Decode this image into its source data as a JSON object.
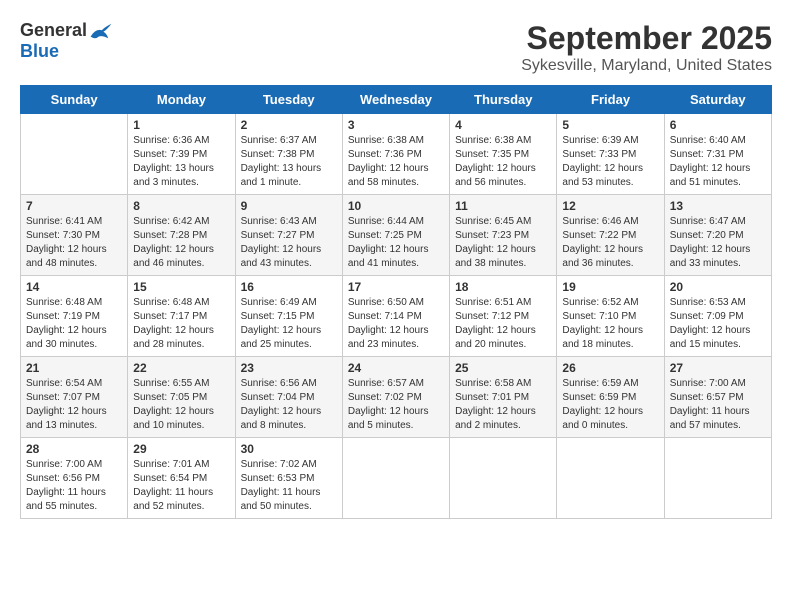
{
  "logo": {
    "general": "General",
    "blue": "Blue"
  },
  "title": "September 2025",
  "subtitle": "Sykesville, Maryland, United States",
  "weekdays": [
    "Sunday",
    "Monday",
    "Tuesday",
    "Wednesday",
    "Thursday",
    "Friday",
    "Saturday"
  ],
  "weeks": [
    {
      "shade": "light",
      "days": [
        {
          "num": "",
          "sunrise": "",
          "sunset": "",
          "daylight": ""
        },
        {
          "num": "1",
          "sunrise": "Sunrise: 6:36 AM",
          "sunset": "Sunset: 7:39 PM",
          "daylight": "Daylight: 13 hours and 3 minutes."
        },
        {
          "num": "2",
          "sunrise": "Sunrise: 6:37 AM",
          "sunset": "Sunset: 7:38 PM",
          "daylight": "Daylight: 13 hours and 1 minute."
        },
        {
          "num": "3",
          "sunrise": "Sunrise: 6:38 AM",
          "sunset": "Sunset: 7:36 PM",
          "daylight": "Daylight: 12 hours and 58 minutes."
        },
        {
          "num": "4",
          "sunrise": "Sunrise: 6:38 AM",
          "sunset": "Sunset: 7:35 PM",
          "daylight": "Daylight: 12 hours and 56 minutes."
        },
        {
          "num": "5",
          "sunrise": "Sunrise: 6:39 AM",
          "sunset": "Sunset: 7:33 PM",
          "daylight": "Daylight: 12 hours and 53 minutes."
        },
        {
          "num": "6",
          "sunrise": "Sunrise: 6:40 AM",
          "sunset": "Sunset: 7:31 PM",
          "daylight": "Daylight: 12 hours and 51 minutes."
        }
      ]
    },
    {
      "shade": "gray",
      "days": [
        {
          "num": "7",
          "sunrise": "Sunrise: 6:41 AM",
          "sunset": "Sunset: 7:30 PM",
          "daylight": "Daylight: 12 hours and 48 minutes."
        },
        {
          "num": "8",
          "sunrise": "Sunrise: 6:42 AM",
          "sunset": "Sunset: 7:28 PM",
          "daylight": "Daylight: 12 hours and 46 minutes."
        },
        {
          "num": "9",
          "sunrise": "Sunrise: 6:43 AM",
          "sunset": "Sunset: 7:27 PM",
          "daylight": "Daylight: 12 hours and 43 minutes."
        },
        {
          "num": "10",
          "sunrise": "Sunrise: 6:44 AM",
          "sunset": "Sunset: 7:25 PM",
          "daylight": "Daylight: 12 hours and 41 minutes."
        },
        {
          "num": "11",
          "sunrise": "Sunrise: 6:45 AM",
          "sunset": "Sunset: 7:23 PM",
          "daylight": "Daylight: 12 hours and 38 minutes."
        },
        {
          "num": "12",
          "sunrise": "Sunrise: 6:46 AM",
          "sunset": "Sunset: 7:22 PM",
          "daylight": "Daylight: 12 hours and 36 minutes."
        },
        {
          "num": "13",
          "sunrise": "Sunrise: 6:47 AM",
          "sunset": "Sunset: 7:20 PM",
          "daylight": "Daylight: 12 hours and 33 minutes."
        }
      ]
    },
    {
      "shade": "light",
      "days": [
        {
          "num": "14",
          "sunrise": "Sunrise: 6:48 AM",
          "sunset": "Sunset: 7:19 PM",
          "daylight": "Daylight: 12 hours and 30 minutes."
        },
        {
          "num": "15",
          "sunrise": "Sunrise: 6:48 AM",
          "sunset": "Sunset: 7:17 PM",
          "daylight": "Daylight: 12 hours and 28 minutes."
        },
        {
          "num": "16",
          "sunrise": "Sunrise: 6:49 AM",
          "sunset": "Sunset: 7:15 PM",
          "daylight": "Daylight: 12 hours and 25 minutes."
        },
        {
          "num": "17",
          "sunrise": "Sunrise: 6:50 AM",
          "sunset": "Sunset: 7:14 PM",
          "daylight": "Daylight: 12 hours and 23 minutes."
        },
        {
          "num": "18",
          "sunrise": "Sunrise: 6:51 AM",
          "sunset": "Sunset: 7:12 PM",
          "daylight": "Daylight: 12 hours and 20 minutes."
        },
        {
          "num": "19",
          "sunrise": "Sunrise: 6:52 AM",
          "sunset": "Sunset: 7:10 PM",
          "daylight": "Daylight: 12 hours and 18 minutes."
        },
        {
          "num": "20",
          "sunrise": "Sunrise: 6:53 AM",
          "sunset": "Sunset: 7:09 PM",
          "daylight": "Daylight: 12 hours and 15 minutes."
        }
      ]
    },
    {
      "shade": "gray",
      "days": [
        {
          "num": "21",
          "sunrise": "Sunrise: 6:54 AM",
          "sunset": "Sunset: 7:07 PM",
          "daylight": "Daylight: 12 hours and 13 minutes."
        },
        {
          "num": "22",
          "sunrise": "Sunrise: 6:55 AM",
          "sunset": "Sunset: 7:05 PM",
          "daylight": "Daylight: 12 hours and 10 minutes."
        },
        {
          "num": "23",
          "sunrise": "Sunrise: 6:56 AM",
          "sunset": "Sunset: 7:04 PM",
          "daylight": "Daylight: 12 hours and 8 minutes."
        },
        {
          "num": "24",
          "sunrise": "Sunrise: 6:57 AM",
          "sunset": "Sunset: 7:02 PM",
          "daylight": "Daylight: 12 hours and 5 minutes."
        },
        {
          "num": "25",
          "sunrise": "Sunrise: 6:58 AM",
          "sunset": "Sunset: 7:01 PM",
          "daylight": "Daylight: 12 hours and 2 minutes."
        },
        {
          "num": "26",
          "sunrise": "Sunrise: 6:59 AM",
          "sunset": "Sunset: 6:59 PM",
          "daylight": "Daylight: 12 hours and 0 minutes."
        },
        {
          "num": "27",
          "sunrise": "Sunrise: 7:00 AM",
          "sunset": "Sunset: 6:57 PM",
          "daylight": "Daylight: 11 hours and 57 minutes."
        }
      ]
    },
    {
      "shade": "light",
      "days": [
        {
          "num": "28",
          "sunrise": "Sunrise: 7:00 AM",
          "sunset": "Sunset: 6:56 PM",
          "daylight": "Daylight: 11 hours and 55 minutes."
        },
        {
          "num": "29",
          "sunrise": "Sunrise: 7:01 AM",
          "sunset": "Sunset: 6:54 PM",
          "daylight": "Daylight: 11 hours and 52 minutes."
        },
        {
          "num": "30",
          "sunrise": "Sunrise: 7:02 AM",
          "sunset": "Sunset: 6:53 PM",
          "daylight": "Daylight: 11 hours and 50 minutes."
        },
        {
          "num": "",
          "sunrise": "",
          "sunset": "",
          "daylight": ""
        },
        {
          "num": "",
          "sunrise": "",
          "sunset": "",
          "daylight": ""
        },
        {
          "num": "",
          "sunrise": "",
          "sunset": "",
          "daylight": ""
        },
        {
          "num": "",
          "sunrise": "",
          "sunset": "",
          "daylight": ""
        }
      ]
    }
  ]
}
